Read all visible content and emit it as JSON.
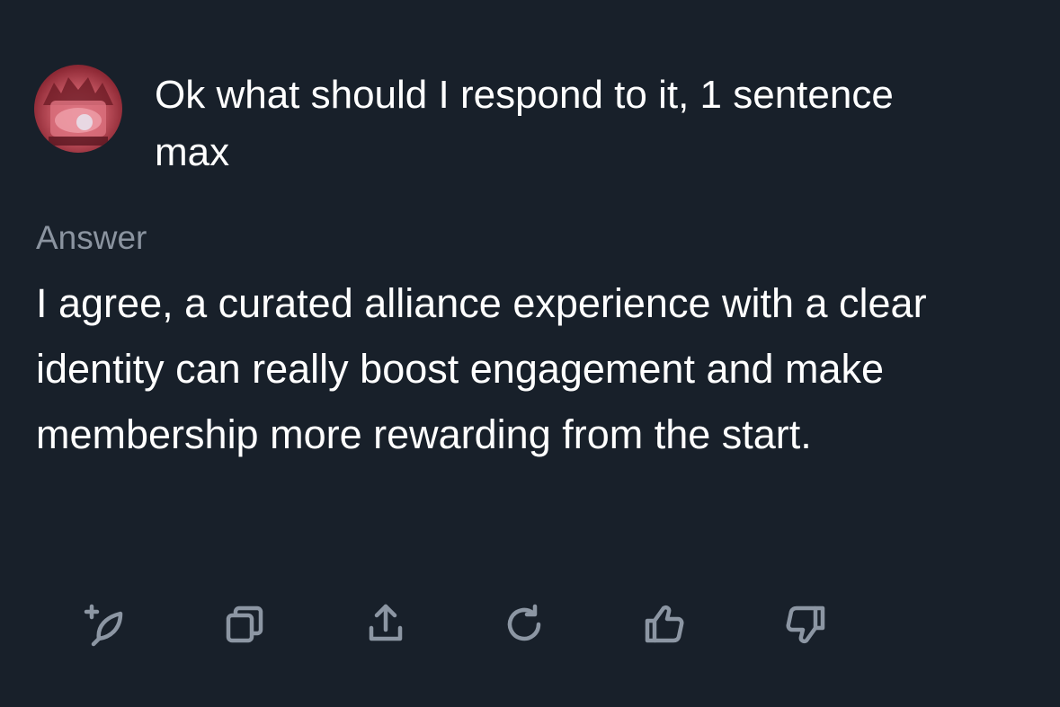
{
  "conversation": {
    "question": "Ok what should I respond to it, 1 sentence max",
    "answer_label": "Answer",
    "answer_text": "I agree, a curated alliance experience with a clear identity can really boost engagement and make membership more rewarding from the start."
  },
  "toolbar": {
    "icons": [
      "new-thread-feather-icon",
      "copy-icon",
      "share-icon",
      "regenerate-icon",
      "thumbs-up-icon",
      "thumbs-down-icon"
    ]
  },
  "colors": {
    "background": "#18202a",
    "text": "#ffffff",
    "muted": "#8b94a0",
    "icon": "#8c96a3"
  }
}
